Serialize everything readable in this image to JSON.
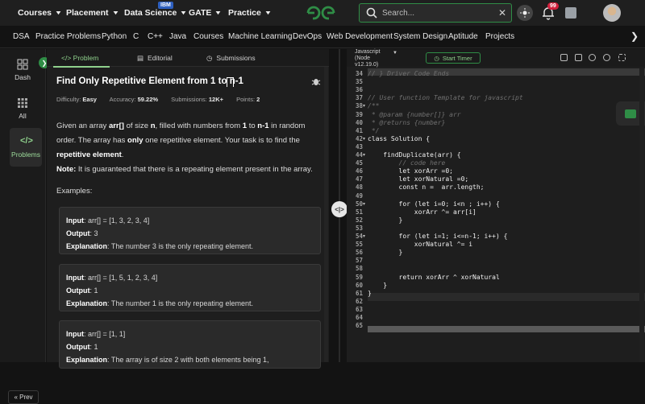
{
  "topnav": {
    "items": [
      "Courses",
      "Placement",
      "Data Science",
      "GATE",
      "Practice"
    ],
    "ibm_badge": "IBM",
    "search_placeholder": "Search...",
    "notification_count": "99"
  },
  "catbar": {
    "items": [
      "DSA",
      "Practice Problems",
      "Python",
      "C",
      "C++",
      "Java",
      "Courses",
      "Machine Learning",
      "DevOps",
      "Web Development",
      "System Design",
      "Aptitude",
      "Projects"
    ]
  },
  "rail": {
    "dash": "Dash",
    "all": "All",
    "problems": "Problems",
    "prev": "« Prev"
  },
  "tabs": {
    "problem": "</> Problem",
    "editorial": "Editorial",
    "submissions": "Submissions"
  },
  "problem": {
    "title": "Find Only Repetitive Element from 1 to n-1",
    "difficulty_label": "Difficulty:",
    "difficulty": "Easy",
    "accuracy_label": "Accuracy:",
    "accuracy": "59.22%",
    "submissions_label": "Submissions:",
    "submissions": "12K+",
    "points_label": "Points:",
    "points": "2",
    "note_label": "Note:",
    "note": "It is guaranteed that there is a repeating element present in the array.",
    "examples_label": "Examples:",
    "examples": [
      {
        "input": "arr[] = [1, 3, 2, 3, 4]",
        "output": "3",
        "explanation": "The number 3 is the only repeating element."
      },
      {
        "input": "arr[] = [1, 5, 1, 2, 3, 4]",
        "output": "1",
        "explanation": "The number 1 is the only repeating element."
      },
      {
        "input": "arr[] = [1, 1]",
        "output": "1",
        "explanation": "The array is of size 2 with both elements being 1,"
      }
    ]
  },
  "editor": {
    "language_line1": "Javascript",
    "language_line2": "(Node",
    "language_line3": "v12.19.0)",
    "timer_label": "Start Timer",
    "lines": [
      {
        "n": "34",
        "t": "// } Driver Code Ends"
      },
      {
        "n": "35",
        "t": ""
      },
      {
        "n": "36",
        "t": ""
      },
      {
        "n": "37",
        "t": "// User function Template for javascript"
      },
      {
        "n": "38",
        "t": "/**"
      },
      {
        "n": "39",
        "t": " * @param {number[]} arr"
      },
      {
        "n": "40",
        "t": " * @returns {number}"
      },
      {
        "n": "41",
        "t": " */"
      },
      {
        "n": "42",
        "t": "class Solution {"
      },
      {
        "n": "43",
        "t": ""
      },
      {
        "n": "44",
        "t": "    findDuplicate(arr) {"
      },
      {
        "n": "45",
        "t": "        // code here"
      },
      {
        "n": "46",
        "t": "        let xorArr =0;"
      },
      {
        "n": "47",
        "t": "        let xorNatural =0;"
      },
      {
        "n": "48",
        "t": "        const n =  arr.length;"
      },
      {
        "n": "49",
        "t": ""
      },
      {
        "n": "50",
        "t": "        for (let i=0; i<n ; i++) {"
      },
      {
        "n": "51",
        "t": "            xorArr ^= arr[i]"
      },
      {
        "n": "52",
        "t": "        }"
      },
      {
        "n": "53",
        "t": ""
      },
      {
        "n": "54",
        "t": "        for (let i=1; i<=n-1; i++) {"
      },
      {
        "n": "55",
        "t": "            xorNatural ^= i"
      },
      {
        "n": "56",
        "t": "        }"
      },
      {
        "n": "57",
        "t": ""
      },
      {
        "n": "58",
        "t": ""
      },
      {
        "n": "59",
        "t": "        return xorArr ^ xorNatural"
      },
      {
        "n": "60",
        "t": "    }"
      },
      {
        "n": "61",
        "t": "}"
      },
      {
        "n": "62",
        "t": ""
      },
      {
        "n": "63",
        "t": ""
      },
      {
        "n": "64",
        "t": ""
      },
      {
        "n": "65",
        "t": ""
      }
    ]
  },
  "colors": {
    "accent_green": "#2f8d46",
    "light_green": "#8fd18c",
    "badge_red": "#d21f3c"
  }
}
